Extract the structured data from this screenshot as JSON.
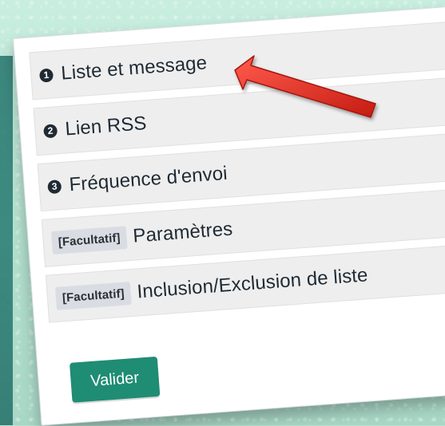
{
  "steps": [
    {
      "number": "1",
      "tag": "",
      "label": "Liste et message"
    },
    {
      "number": "2",
      "tag": "",
      "label": "Lien RSS"
    },
    {
      "number": "3",
      "tag": "",
      "label": "Fréquence d'envoi"
    },
    {
      "number": "",
      "tag": "[Facultatif]",
      "label": "Paramètres"
    },
    {
      "number": "",
      "tag": "[Facultatif]",
      "label": "Inclusion/Exclusion de liste"
    }
  ],
  "actions": {
    "submit_label": "Valider"
  },
  "colors": {
    "background": "#b9e3d2",
    "panel": "#ffffff",
    "step_bg": "#eeeeee",
    "text": "#1f2a33",
    "tag_bg": "#d9dde3",
    "button": "#1f8c74",
    "arrow": "#e3261b"
  },
  "icons": {
    "annotation": "red-arrow-icon"
  }
}
